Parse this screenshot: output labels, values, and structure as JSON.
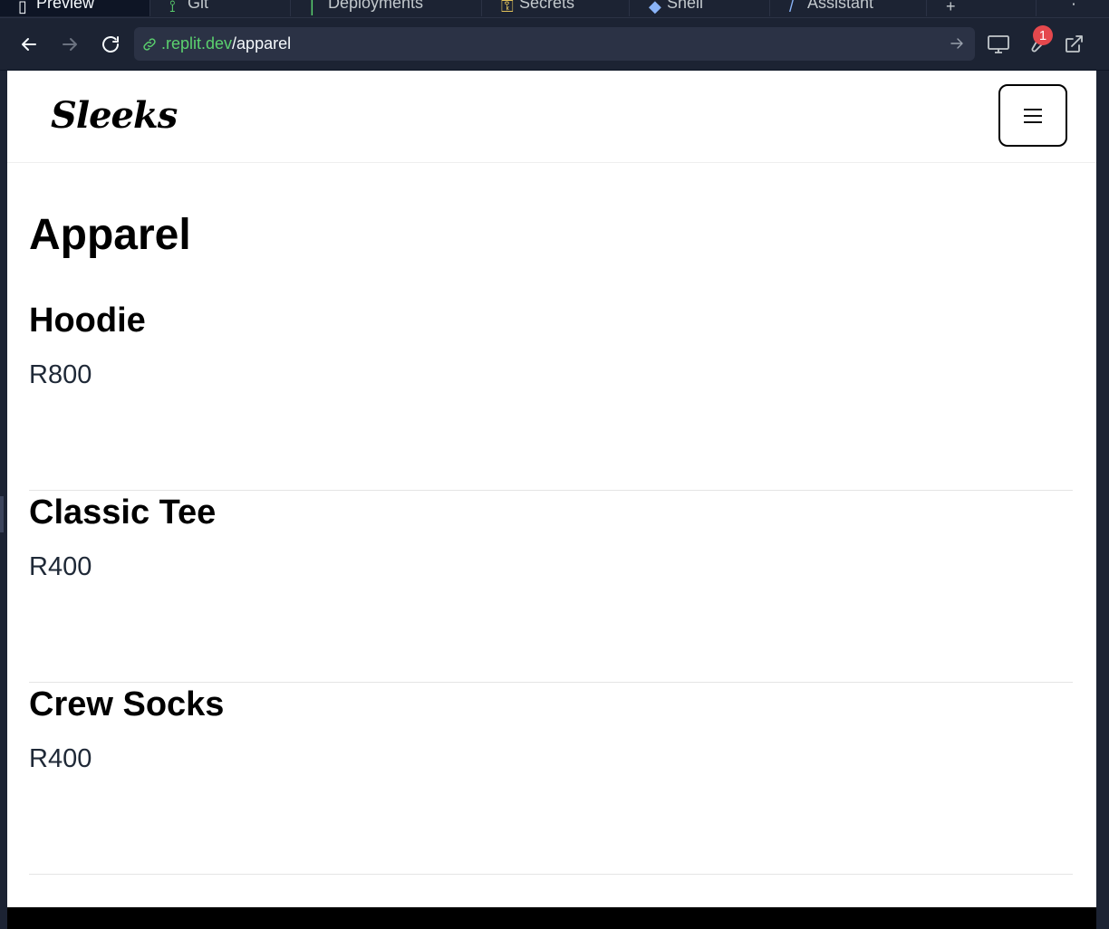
{
  "workspace": {
    "tabs": [
      {
        "label": "Preview",
        "active": true
      },
      {
        "label": "Git",
        "active": false
      },
      {
        "label": "Deployments",
        "active": false
      },
      {
        "label": "Secrets",
        "active": false
      },
      {
        "label": "Shell",
        "active": false
      },
      {
        "label": "Assistant",
        "active": false
      }
    ],
    "url_host": ".replit.dev",
    "url_path": "/apparel",
    "notification_count": "1",
    "colors": {
      "host": "#5bd16e",
      "badge": "#e5484d"
    }
  },
  "site": {
    "logo": "Sleeks",
    "menu_icon": "hamburger-icon"
  },
  "page": {
    "title": "Apparel",
    "products": [
      {
        "name": "Hoodie",
        "price": "R800"
      },
      {
        "name": "Classic Tee",
        "price": "R400"
      },
      {
        "name": "Crew Socks",
        "price": "R400"
      }
    ]
  }
}
